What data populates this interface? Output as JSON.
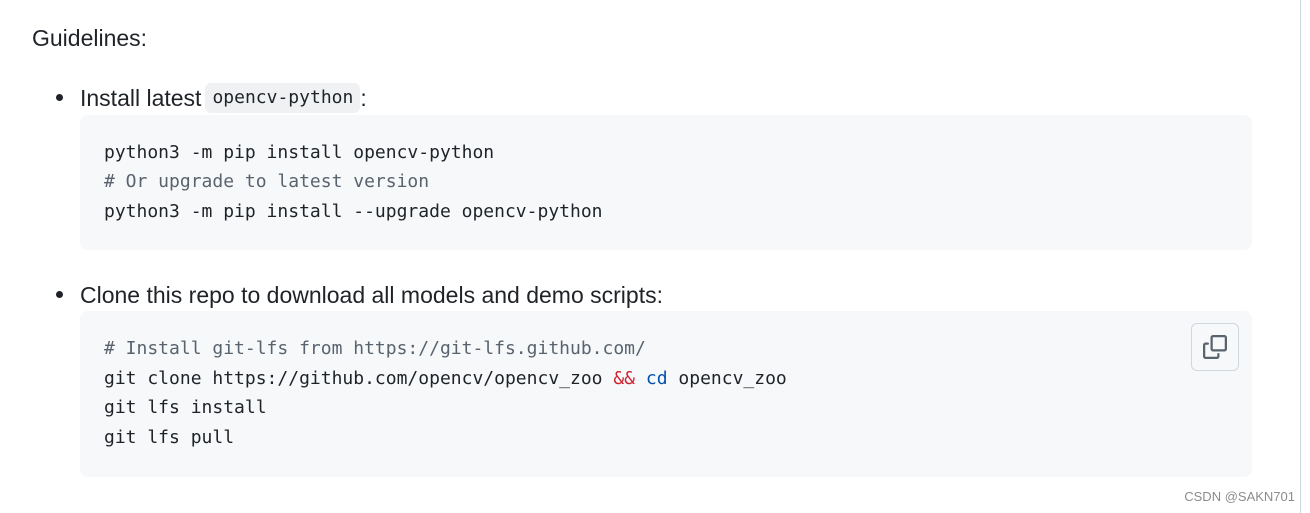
{
  "section": {
    "heading": "Guidelines:"
  },
  "items": [
    {
      "text_before": "Install latest",
      "inline_code": "opencv-python",
      "text_after": ":",
      "code_lines": [
        "python3 -m pip install opencv-python",
        "# Or upgrade to latest version",
        "python3 -m pip install --upgrade opencv-python"
      ]
    },
    {
      "text": "Clone this repo to download all models and demo scripts:",
      "code_lines": {
        "comment": "# Install git-lfs from https://git-lfs.github.com/",
        "clone_cmd": "git clone https://github.com/opencv/opencv_zoo ",
        "and_op": "&&",
        "cd_cmd": "cd",
        "cd_arg": " opencv_zoo",
        "lfs_install": "git lfs install",
        "lfs_pull": "git lfs pull"
      },
      "copy_icon": "copy-icon"
    }
  ],
  "watermark": "CSDN @SAKN701",
  "colors": {
    "code_background": "#f6f8fa",
    "comment": "#59636e",
    "operator": "#cf222e",
    "builtin": "#0550ae"
  }
}
